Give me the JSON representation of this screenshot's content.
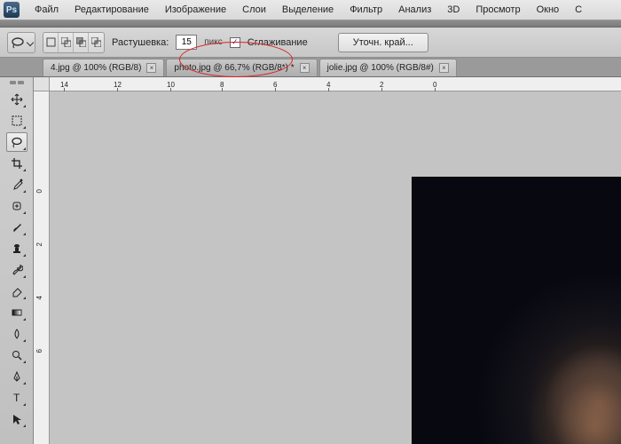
{
  "menu": [
    "Файл",
    "Редактирование",
    "Изображение",
    "Слои",
    "Выделение",
    "Фильтр",
    "Анализ",
    "3D",
    "Просмотр",
    "Окно",
    "С"
  ],
  "options": {
    "feather_label": "Растушевка:",
    "feather_value": "15",
    "feather_unit": "пикс",
    "antialias_label": "Сглаживание",
    "refine_label": "Уточн. край..."
  },
  "tabs": [
    {
      "label": "4.jpg @ 100% (RGB/8)",
      "active": false
    },
    {
      "label": "photo.jpg @ 66,7% (RGB/8*) *",
      "active": true
    },
    {
      "label": "jolie.jpg @ 100% (RGB/8#)",
      "active": false
    }
  ],
  "ruler_h": [
    "14",
    "12",
    "10",
    "8",
    "6",
    "4",
    "2",
    "0"
  ],
  "ruler_v": [
    "0",
    "2",
    "4",
    "6"
  ],
  "tools": [
    "move",
    "marquee",
    "lasso",
    "crop",
    "eyedropper",
    "healing",
    "brush",
    "stamp",
    "history-brush",
    "eraser",
    "gradient",
    "blur",
    "dodge",
    "pen",
    "type",
    "path-select"
  ],
  "selected_tool": "lasso"
}
